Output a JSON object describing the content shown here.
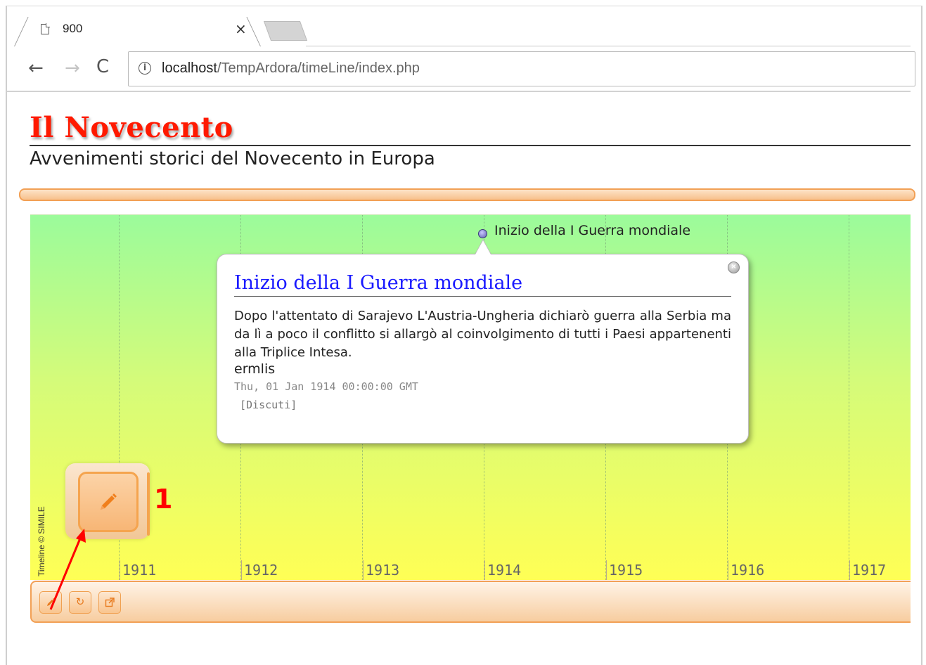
{
  "browser": {
    "tab_title": "900",
    "tab_close": "×",
    "url_host": "localhost",
    "url_path": "/TempArdora/timeLine/index.php"
  },
  "page": {
    "title": "Il Novecento",
    "subtitle": "Avvenimenti storici del Novecento in Europa"
  },
  "timeline": {
    "credit": "Timeline © SIMILE",
    "years": [
      "1911",
      "1912",
      "1913",
      "1914",
      "1915",
      "1916",
      "1917"
    ],
    "event_label": "Inizio della I Guerra mondiale"
  },
  "bubble": {
    "title": "Inizio della I Guerra mondiale",
    "body": "Dopo l'attentato di Sarajevo L'Austria-Ungheria dichiarò guerra alla Serbia ma da lì a poco il conflitto si allargò al coinvolgimento di tutti i Paesi appartenenti alla Triplice Intesa.",
    "author": "ermlis",
    "date": "Thu, 01 Jan 1914 00:00:00 GMT",
    "discuss": "[Discuti]",
    "close_icon": "close-icon"
  },
  "controls": {
    "buttons": [
      "edit-icon",
      "refresh-icon",
      "external-link-icon"
    ]
  },
  "annotation": {
    "callout_number": "1",
    "callout_color": "#ff0000"
  },
  "colors": {
    "title_red": "#ff1a00",
    "accent_orange": "#f2a055",
    "link_blue": "#1a1aff"
  }
}
